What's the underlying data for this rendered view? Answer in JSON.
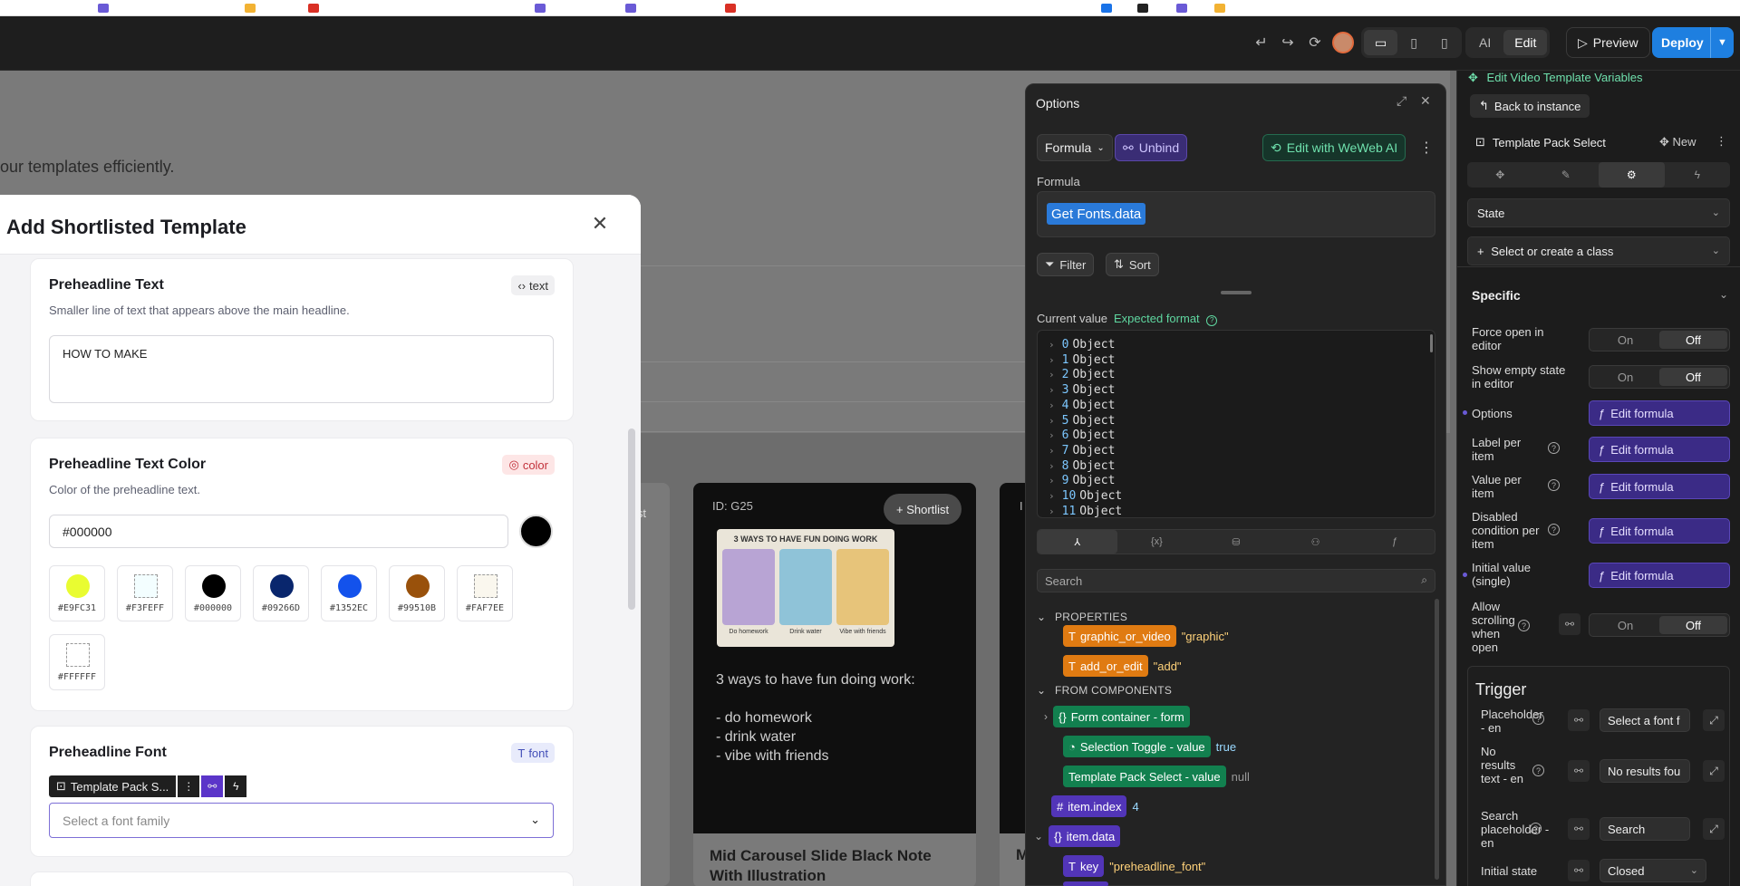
{
  "toolbar": {
    "mode_ai": "AI",
    "mode_edit": "Edit",
    "preview_label": "Preview",
    "deploy_label": "Deploy"
  },
  "canvas": {
    "subtitle": "our templates efficiently.",
    "card": {
      "id_label": "ID: G25",
      "shortlist_label": "+ Shortlist",
      "thumb_title": "3 WAYS TO HAVE FUN DOING WORK",
      "thumb_captions": [
        "Do homework",
        "Drink water",
        "Vibe with friends"
      ],
      "body_lines": [
        "3 ways to have fun doing work:",
        "",
        "- do homework",
        "- drink water",
        "- vibe with friends"
      ],
      "footer_title": "Mid Carousel Slide Black Note With Illustration"
    },
    "left_card_fragment": "ist",
    "right_card_fragment": "I",
    "right_footer_fragment": "M"
  },
  "modal": {
    "title": "Add Shortlisted Template",
    "sections": {
      "preheadline_text": {
        "title": "Preheadline Text",
        "badge": "text",
        "description": "Smaller line of text that appears above the main headline.",
        "value": "HOW TO MAKE"
      },
      "preheadline_color": {
        "title": "Preheadline Text Color",
        "badge": "color",
        "description": "Color of the preheadline text.",
        "value": "#000000",
        "swatches": [
          {
            "label": "#E9FC31",
            "color": "#E9FC31",
            "dashed": false
          },
          {
            "label": "#F3FEFF",
            "color": "#F3FEFF",
            "dashed": true
          },
          {
            "label": "#000000",
            "color": "#000000",
            "dashed": false
          },
          {
            "label": "#09266D",
            "color": "#09266D",
            "dashed": false
          },
          {
            "label": "#1352EC",
            "color": "#1352EC",
            "dashed": false
          },
          {
            "label": "#99510B",
            "color": "#99510B",
            "dashed": false
          },
          {
            "label": "#FAF7EE",
            "color": "#FAF7EE",
            "dashed": true
          },
          {
            "label": "#FFFFFF",
            "color": "#FFFFFF",
            "dashed": true
          }
        ]
      },
      "preheadline_font": {
        "title": "Preheadline Font",
        "badge": "font",
        "placeholder": "Select a font family",
        "element_label": "Template Pack S..."
      }
    }
  },
  "options": {
    "title": "Options",
    "formula_mode": "Formula",
    "unbind_label": "Unbind",
    "weweb_ai_label": "Edit with WeWeb AI",
    "formula_label": "Formula",
    "formula_token": "Get Fonts.data",
    "filter_label": "Filter",
    "sort_label": "Sort",
    "current_value_label": "Current value",
    "expected_format_label": "Expected format",
    "value_rows": [
      {
        "index": "0",
        "type": "Object"
      },
      {
        "index": "1",
        "type": "Object"
      },
      {
        "index": "2",
        "type": "Object"
      },
      {
        "index": "3",
        "type": "Object"
      },
      {
        "index": "4",
        "type": "Object"
      },
      {
        "index": "5",
        "type": "Object"
      },
      {
        "index": "6",
        "type": "Object"
      },
      {
        "index": "7",
        "type": "Object"
      },
      {
        "index": "8",
        "type": "Object"
      },
      {
        "index": "9",
        "type": "Object"
      },
      {
        "index": "10",
        "type": "Object"
      },
      {
        "index": "11",
        "type": "Object"
      }
    ],
    "search_placeholder": "Search",
    "properties_label": "PROPERTIES",
    "properties": [
      {
        "name": "graphic_or_video",
        "value": "\"graphic\""
      },
      {
        "name": "add_or_edit",
        "value": "\"add\""
      }
    ],
    "from_components_label": "FROM COMPONENTS",
    "components": [
      {
        "name": "Form container - form",
        "value": ""
      },
      {
        "name": "Selection Toggle - value",
        "value": "true"
      },
      {
        "name": "Template Pack Select - value",
        "value": "null"
      }
    ],
    "item_index": {
      "name": "item.index",
      "value": "4"
    },
    "item_data": {
      "name": "item.data"
    },
    "item_key": {
      "name": "key",
      "value": "\"preheadline_font\""
    }
  },
  "side": {
    "heading": "Edit Video Template Variables",
    "back_label": "Back to instance",
    "element_title": "Template Pack Select",
    "new_label": "New",
    "state_label": "State",
    "class_label": "Select or create a class",
    "specific_label": "Specific",
    "on_label": "On",
    "off_label": "Off",
    "edit_formula_label": "Edit formula",
    "props": {
      "force_open": "Force open in editor",
      "show_empty": "Show empty state in editor",
      "options": "Options",
      "label_per_item": "Label per item",
      "value_per_item": "Value per item",
      "disabled_condition": "Disabled condition per item",
      "initial_value": "Initial value (single)",
      "allow_scrolling": "Allow scrolling when open"
    },
    "trigger_title": "Trigger",
    "trigger": {
      "placeholder_label": "Placeholder - en",
      "placeholder_value": "Select a font f",
      "no_results_label": "No results text - en",
      "no_results_value": "No results fou",
      "search_placeholder_label": "Search placeholder - en",
      "search_placeholder_value": "Search",
      "initial_state_label": "Initial state",
      "initial_state_value": "Closed"
    }
  }
}
